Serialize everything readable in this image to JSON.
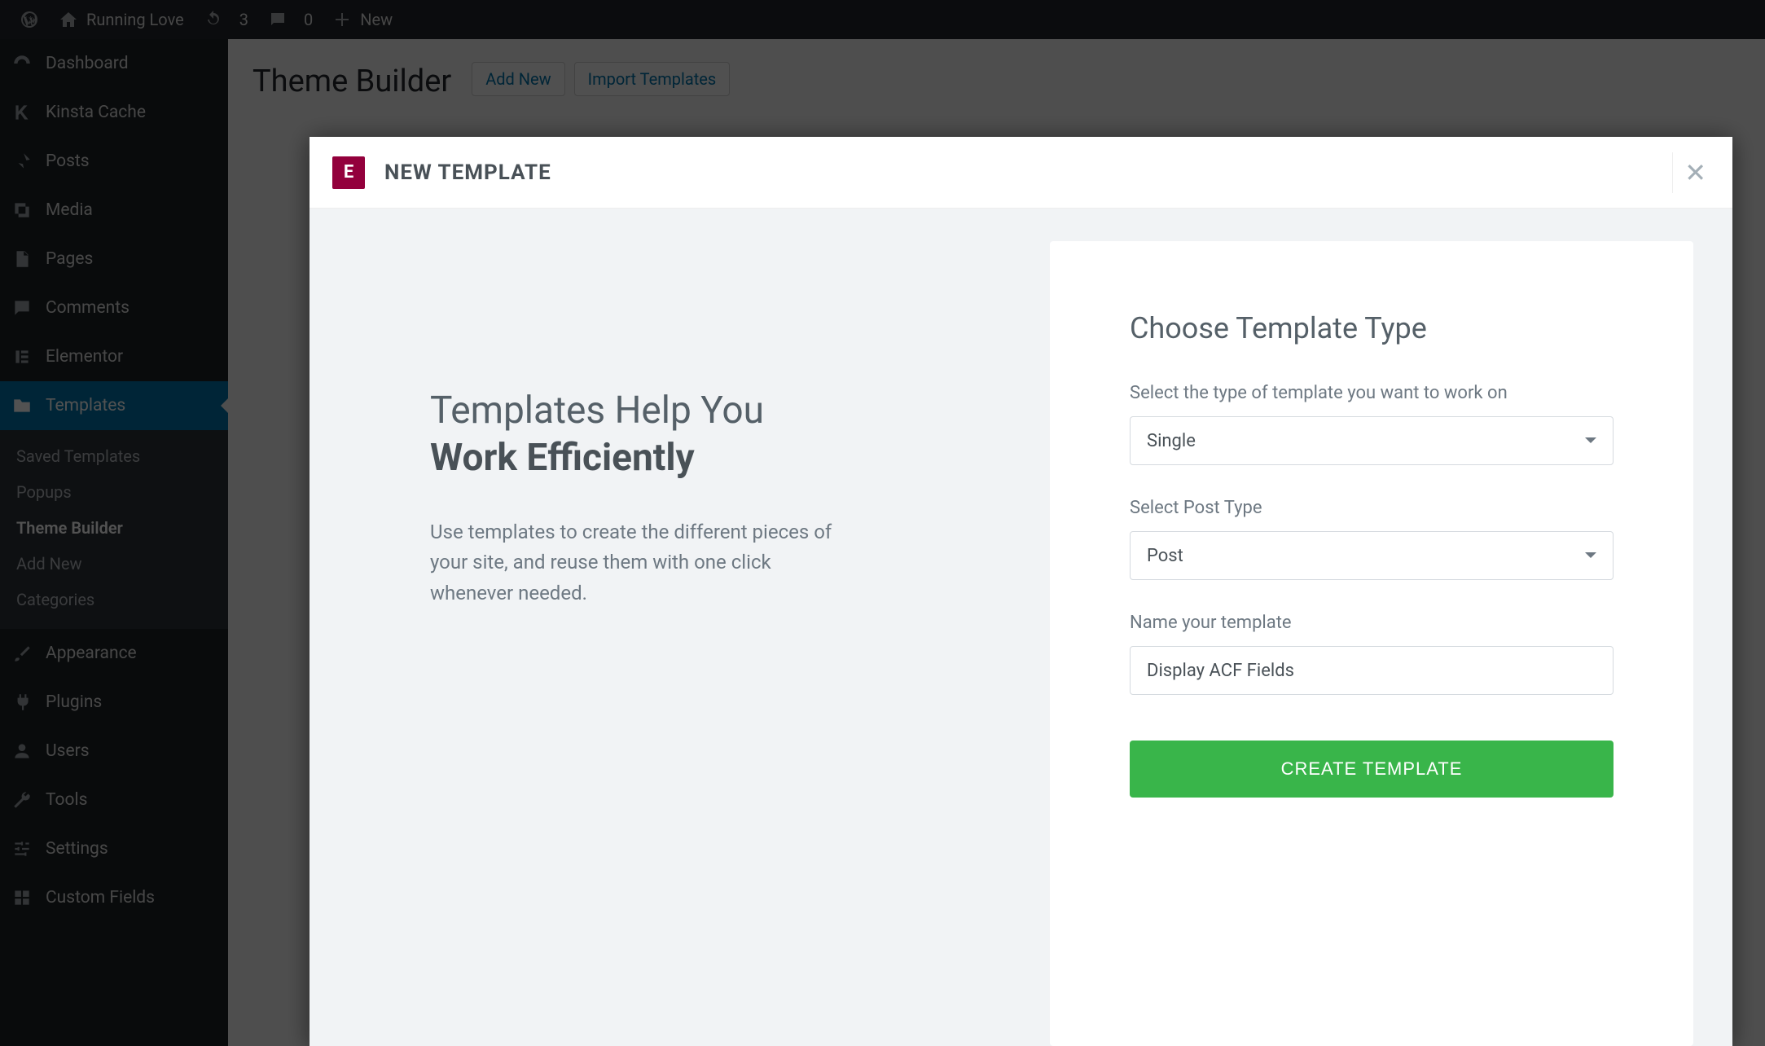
{
  "adminbar": {
    "site_name": "Running Love",
    "update_count": "3",
    "comment_count": "0",
    "new_label": "New"
  },
  "sidebar": {
    "items": [
      {
        "label": "Dashboard"
      },
      {
        "label": "Kinsta Cache"
      },
      {
        "label": "Posts"
      },
      {
        "label": "Media"
      },
      {
        "label": "Pages"
      },
      {
        "label": "Comments"
      },
      {
        "label": "Elementor"
      },
      {
        "label": "Templates"
      },
      {
        "label": "Appearance"
      },
      {
        "label": "Plugins"
      },
      {
        "label": "Users"
      },
      {
        "label": "Tools"
      },
      {
        "label": "Settings"
      },
      {
        "label": "Custom Fields"
      }
    ],
    "submenu": [
      {
        "label": "Saved Templates"
      },
      {
        "label": "Popups"
      },
      {
        "label": "Theme Builder"
      },
      {
        "label": "Add New"
      },
      {
        "label": "Categories"
      }
    ]
  },
  "page": {
    "title": "Theme Builder",
    "add_new": "Add New",
    "import": "Import Templates"
  },
  "modal": {
    "header_title": "NEW TEMPLATE",
    "logo_letter": "E",
    "left_heading_line1": "Templates Help You",
    "left_heading_line2": "Work Efficiently",
    "left_paragraph": "Use templates to create the different pieces of your site, and reuse them with one click whenever needed.",
    "form": {
      "heading": "Choose Template Type",
      "type_label": "Select the type of template you want to work on",
      "type_value": "Single",
      "posttype_label": "Select Post Type",
      "posttype_value": "Post",
      "name_label": "Name your template",
      "name_value": "Display ACF Fields",
      "submit_label": "CREATE TEMPLATE"
    }
  }
}
